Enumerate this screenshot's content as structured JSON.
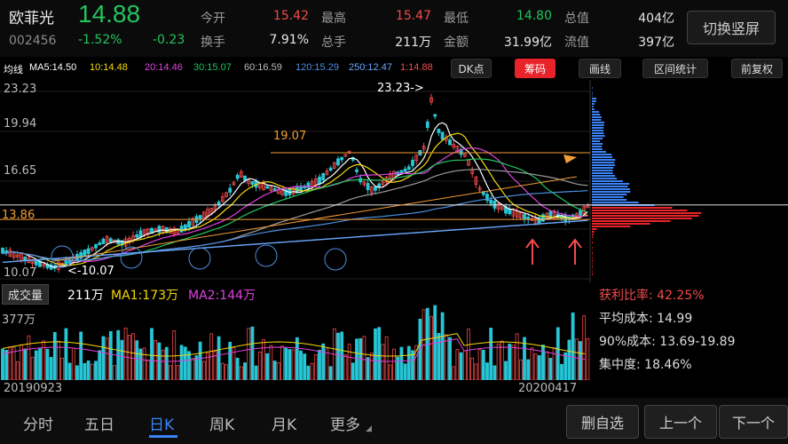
{
  "stock": {
    "name": "欧菲光",
    "code": "002456",
    "price": "14.88",
    "pct": "-1.52%",
    "change": "-0.23"
  },
  "quote": {
    "row1": [
      {
        "label": "今开",
        "value": "15.42",
        "color": "red"
      },
      {
        "label": "最高",
        "value": "15.47",
        "color": "red"
      },
      {
        "label": "最低",
        "value": "14.80",
        "color": "green"
      },
      {
        "label": "总值",
        "value": "404亿",
        "color": "white"
      }
    ],
    "row2": [
      {
        "label": "换手",
        "value": "7.91%",
        "color": "white"
      },
      {
        "label": "总手",
        "value": "211万",
        "color": "white"
      },
      {
        "label": "金额",
        "value": "31.99亿",
        "color": "white"
      },
      {
        "label": "流值",
        "value": "397亿",
        "color": "white"
      }
    ]
  },
  "switch_label": "切换竖屏",
  "ma_bar": [
    {
      "text": "均线",
      "color": "#ffffff"
    },
    {
      "text": "MA5:14.50",
      "color": "#ffffff"
    },
    {
      "text": "10:14.48",
      "color": "#f5d90a"
    },
    {
      "text": "20:14.46",
      "color": "#e040e0"
    },
    {
      "text": "30:15.07",
      "color": "#22c55e"
    },
    {
      "text": "60:16.59",
      "color": "#bbbbbb"
    },
    {
      "text": "120:15.29",
      "color": "#4d8fe0"
    },
    {
      "text": "250:12.47",
      "color": "#6aa8ff"
    },
    {
      "text": "1:14.88",
      "color": "#f24b4b"
    }
  ],
  "tools": {
    "dk": "DK点",
    "chip": "筹码",
    "draw": "画线",
    "range": "区间统计",
    "adjust": "前复权"
  },
  "chart": {
    "y_labels": [
      "23.23",
      "19.94",
      "16.65",
      "13.86",
      "10.07"
    ],
    "high_label": "23.23->",
    "low_label": "<-10.07",
    "line_label_1907": "19.07",
    "price_line_color": "#f29d38"
  },
  "volume": {
    "title": "成交量",
    "total": "211万",
    "ma1": "MA1:173万",
    "ma2": "MA2:144万",
    "y_label": "377万",
    "date_start": "20190923",
    "date_end": "20200417"
  },
  "stats": {
    "profit": "获利比率: 42.25%",
    "avg": "平均成本: 14.99",
    "cost90": "90%成本: 13.69-19.89",
    "conc": "集中度: 18.46%"
  },
  "tabs": [
    "分时",
    "五日",
    "日K",
    "周K",
    "月K",
    "更多"
  ],
  "active_tab": "日K",
  "buttons": {
    "delete": "删自选",
    "prev": "上一个",
    "next": "下一个"
  }
}
